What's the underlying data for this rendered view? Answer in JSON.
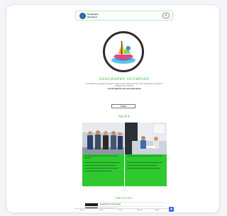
{
  "header": {
    "logo_text": "Geography Olympiad",
    "menu_icon": "hamburger-icon"
  },
  "hero": {
    "title": "GEOGRAPHY OLYMPIAD",
    "description": "An olympiad in geography for students: tasks, results, teams and news of the olympiad in one place for participants and teachers.",
    "emphasis": "Look through the news and results below",
    "button_label": "MORE"
  },
  "news": {
    "heading": "NEWS",
    "items": [
      {
        "text": "Olympiad participants and jury after the award ceremony"
      },
      {
        "text": "Participants working on the practical round tasks"
      }
    ],
    "pager": "1 2 3 4 5"
  },
  "section2": {
    "heading": "ARTICLES",
    "rows": [
      {
        "text": "Preparation for the olympiad"
      },
      {
        "text": "Tasks of previous years"
      }
    ]
  },
  "bottom_nav": {
    "items": [
      "Home",
      "News",
      "Tasks",
      "Results",
      "About"
    ],
    "arrow_icon": "arrow-up-icon"
  },
  "colors": {
    "accent": "#2bb53a",
    "news_card": "#2ec82f",
    "page_bg": "#f3f5f9"
  }
}
